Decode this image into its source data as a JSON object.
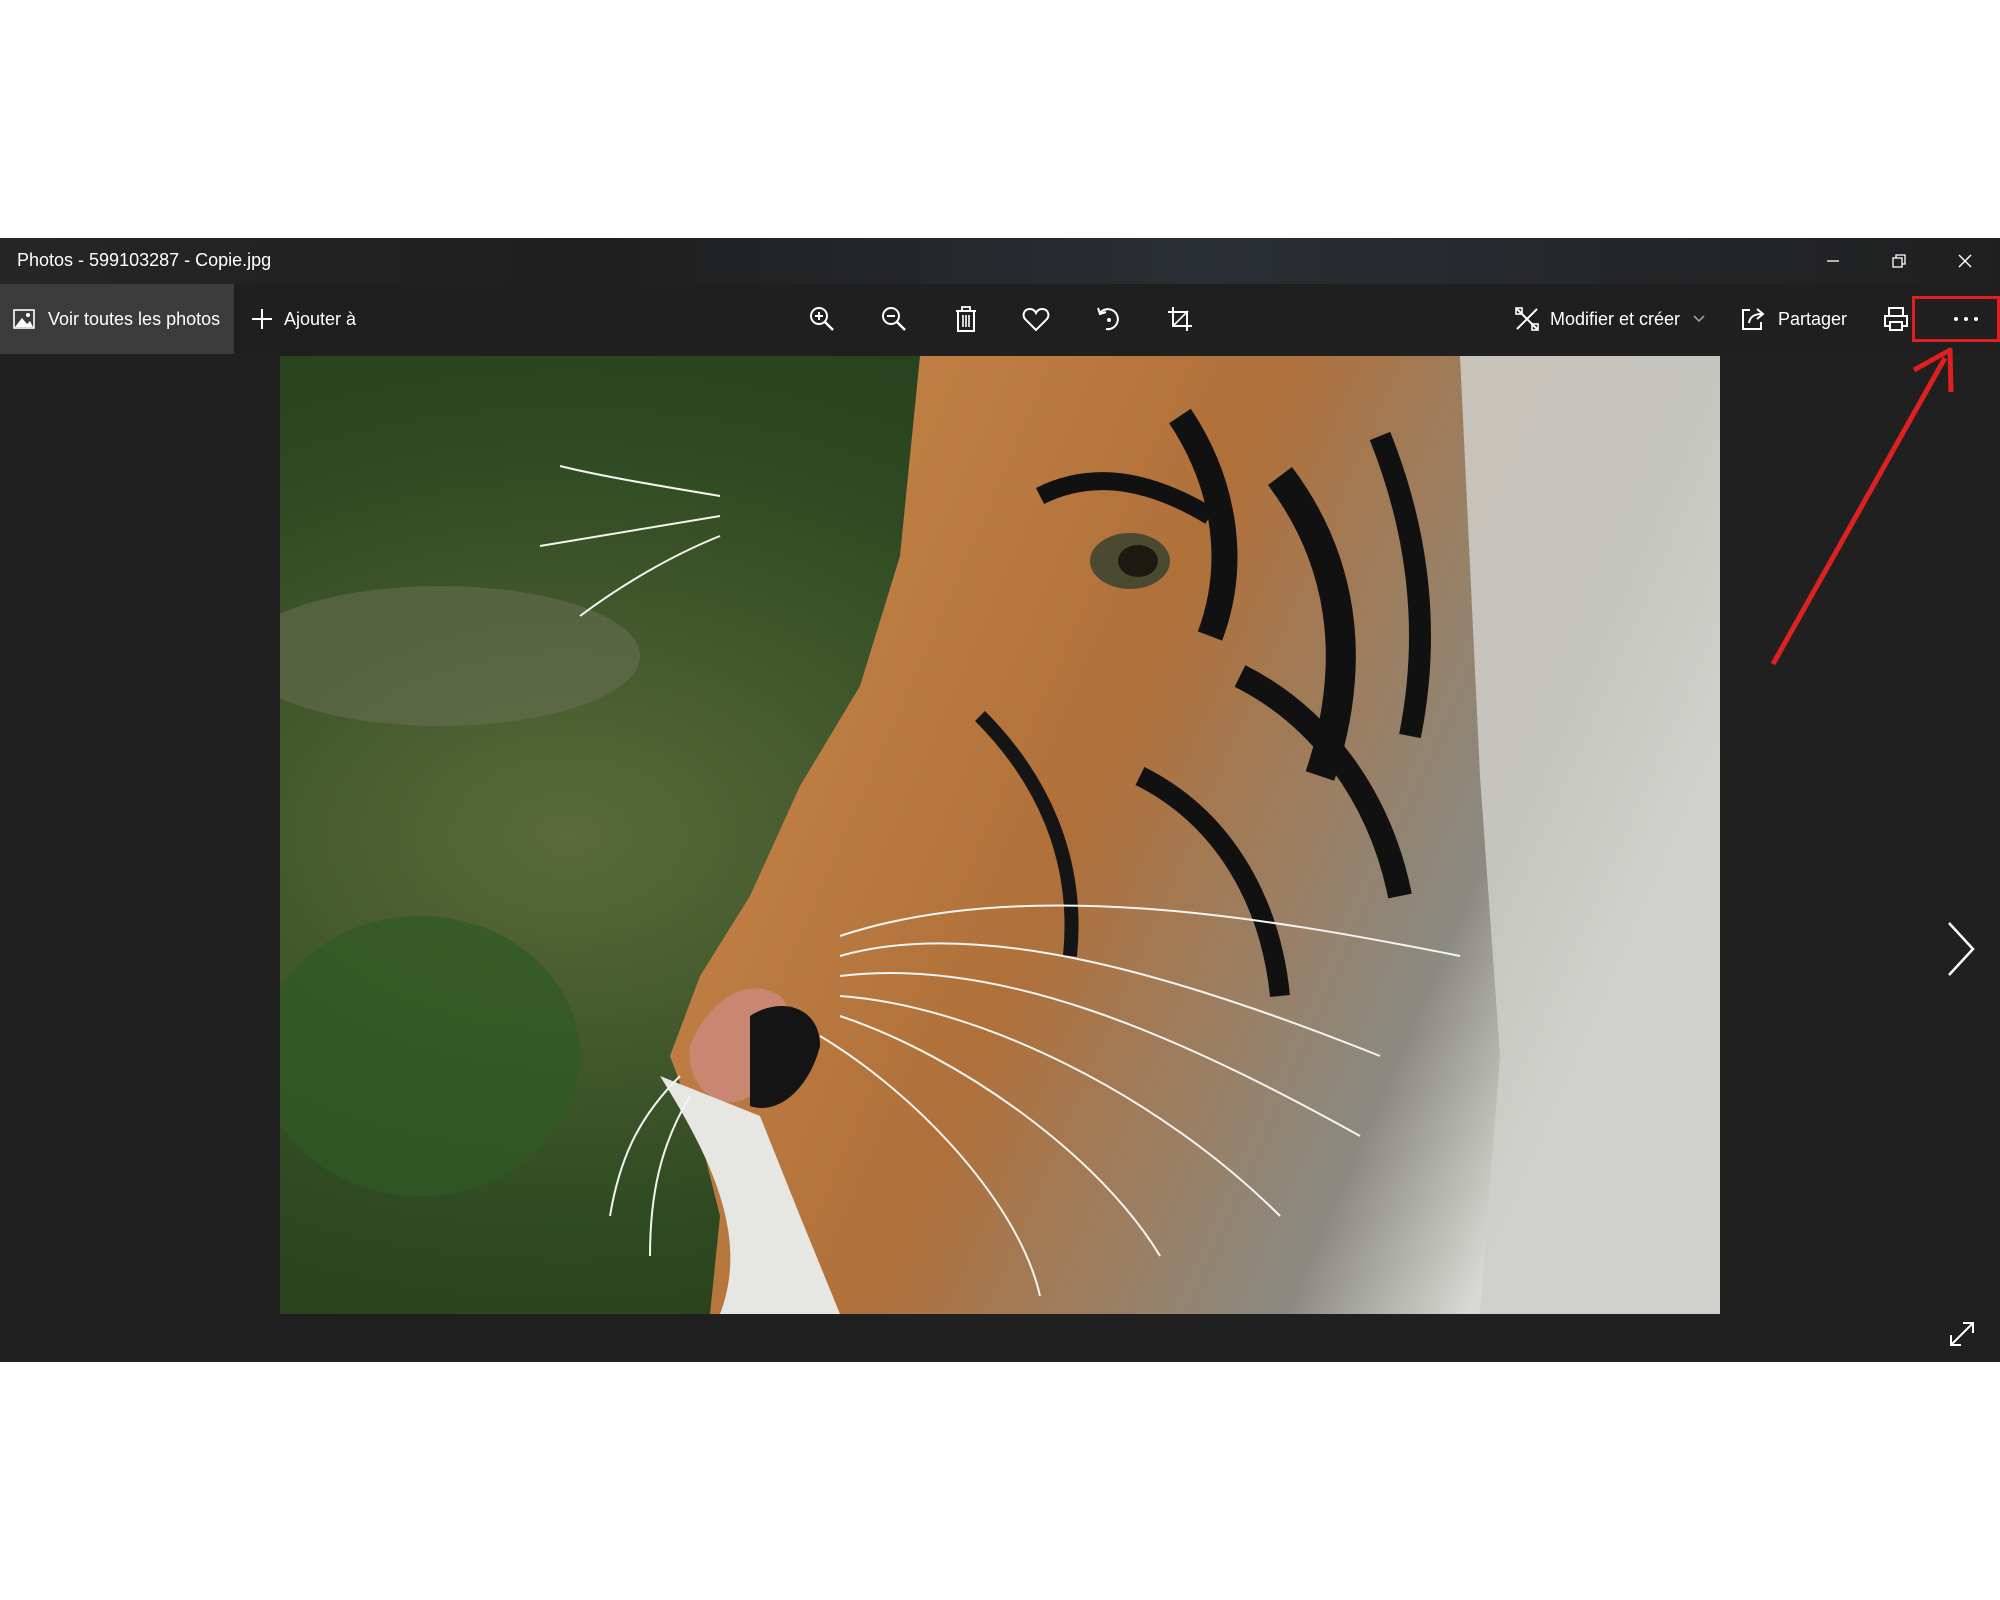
{
  "window": {
    "title": "Photos - 599103287 - Copie.jpg"
  },
  "titlebar_buttons": {
    "minimize": "minimize-icon",
    "restore": "restore-icon",
    "close": "close-icon"
  },
  "toolbar": {
    "view_all_label": "Voir toutes les photos",
    "add_to_label": "Ajouter à",
    "edit_create_label": "Modifier et créer",
    "share_label": "Partager",
    "icons": [
      "zoom-in-icon",
      "zoom-out-icon",
      "delete-icon",
      "heart-icon",
      "rotate-icon",
      "crop-icon",
      "print-icon",
      "more-icon"
    ]
  },
  "photo": {
    "subject": "tiger"
  },
  "colors": {
    "background": "#202020",
    "toolbar": "#1f1f1f",
    "active_button": "#3b3b3b",
    "annotation": "#e02020"
  }
}
